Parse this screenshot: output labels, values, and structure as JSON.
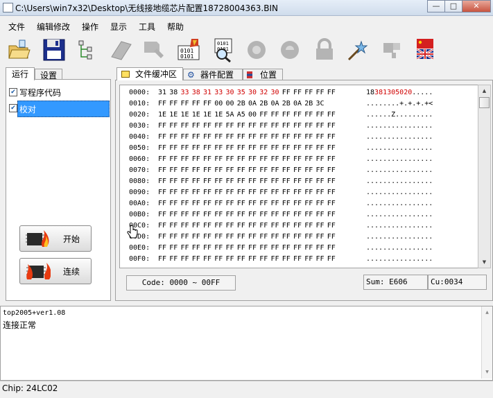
{
  "window": {
    "title": "C:\\Users\\win7x32\\Desktop\\无线接地缆芯片配置18728004363.BIN",
    "minimize": "—",
    "maximize": "□",
    "close": "✕"
  },
  "menu": [
    "文件",
    "编辑修改",
    "操作",
    "显示",
    "工具",
    "帮助"
  ],
  "toolbar": [
    {
      "name": "open-folder-icon"
    },
    {
      "name": "save-disk-icon"
    },
    {
      "name": "tree-icon"
    },
    {
      "name": "erase-icon"
    },
    {
      "name": "blank-check-icon"
    },
    {
      "name": "program-icon"
    },
    {
      "name": "read-icon"
    },
    {
      "name": "verify-icon"
    },
    {
      "name": "encrypt-icon"
    },
    {
      "name": "lock-icon"
    },
    {
      "name": "magic-icon"
    },
    {
      "name": "chip-icon"
    },
    {
      "name": "language-flag-icon"
    }
  ],
  "left_tabs": [
    "运行",
    "设置"
  ],
  "operations": [
    {
      "label": "写程序代码",
      "checked": true,
      "selected": false
    },
    {
      "label": "校对",
      "checked": true,
      "selected": true
    }
  ],
  "buttons": {
    "start": "开始",
    "continuous": "连续"
  },
  "right_tabs": [
    "文件缓冲区",
    "器件配置",
    "位置"
  ],
  "hex_rows": [
    {
      "addr": "0000:",
      "bytes": [
        "31",
        "38",
        "33",
        "38",
        "31",
        "33",
        "30",
        "35",
        "30",
        "32",
        "30",
        "FF",
        "FF",
        "FF",
        "FF",
        "FF"
      ],
      "red_from": 2,
      "red_to": 10,
      "ascii_plain": "18",
      "ascii_red": "381305020",
      "ascii_tail": "....."
    },
    {
      "addr": "0010:",
      "bytes": [
        "FF",
        "FF",
        "FF",
        "FF",
        "FF",
        "00",
        "00",
        "2B",
        "0A",
        "2B",
        "0A",
        "2B",
        "0A",
        "2B",
        "3C"
      ],
      "red_from": -1,
      "red_to": -1,
      "ascii_plain": "........+.+.+.+<",
      "ascii_red": "",
      "ascii_tail": ""
    },
    {
      "addr": "0020:",
      "bytes": [
        "1E",
        "1E",
        "1E",
        "1E",
        "1E",
        "1E",
        "5A",
        "A5",
        "00",
        "FF",
        "FF",
        "FF",
        "FF",
        "FF",
        "FF",
        "FF"
      ],
      "red_from": -1,
      "red_to": -1,
      "ascii_plain": "......Z.........",
      "ascii_red": "",
      "ascii_tail": ""
    },
    {
      "addr": "0030:",
      "bytes": [
        "FF",
        "FF",
        "FF",
        "FF",
        "FF",
        "FF",
        "FF",
        "FF",
        "FF",
        "FF",
        "FF",
        "FF",
        "FF",
        "FF",
        "FF",
        "FF"
      ],
      "red_from": -1,
      "red_to": -1,
      "ascii_plain": "................",
      "ascii_red": "",
      "ascii_tail": ""
    },
    {
      "addr": "0040:",
      "bytes": [
        "FF",
        "FF",
        "FF",
        "FF",
        "FF",
        "FF",
        "FF",
        "FF",
        "FF",
        "FF",
        "FF",
        "FF",
        "FF",
        "FF",
        "FF",
        "FF"
      ],
      "red_from": -1,
      "red_to": -1,
      "ascii_plain": "................",
      "ascii_red": "",
      "ascii_tail": ""
    },
    {
      "addr": "0050:",
      "bytes": [
        "FF",
        "FF",
        "FF",
        "FF",
        "FF",
        "FF",
        "FF",
        "FF",
        "FF",
        "FF",
        "FF",
        "FF",
        "FF",
        "FF",
        "FF",
        "FF"
      ],
      "red_from": -1,
      "red_to": -1,
      "ascii_plain": "................",
      "ascii_red": "",
      "ascii_tail": ""
    },
    {
      "addr": "0060:",
      "bytes": [
        "FF",
        "FF",
        "FF",
        "FF",
        "FF",
        "FF",
        "FF",
        "FF",
        "FF",
        "FF",
        "FF",
        "FF",
        "FF",
        "FF",
        "FF",
        "FF"
      ],
      "red_from": -1,
      "red_to": -1,
      "ascii_plain": "................",
      "ascii_red": "",
      "ascii_tail": ""
    },
    {
      "addr": "0070:",
      "bytes": [
        "FF",
        "FF",
        "FF",
        "FF",
        "FF",
        "FF",
        "FF",
        "FF",
        "FF",
        "FF",
        "FF",
        "FF",
        "FF",
        "FF",
        "FF",
        "FF"
      ],
      "red_from": -1,
      "red_to": -1,
      "ascii_plain": "................",
      "ascii_red": "",
      "ascii_tail": ""
    },
    {
      "addr": "0080:",
      "bytes": [
        "FF",
        "FF",
        "FF",
        "FF",
        "FF",
        "FF",
        "FF",
        "FF",
        "FF",
        "FF",
        "FF",
        "FF",
        "FF",
        "FF",
        "FF",
        "FF"
      ],
      "red_from": -1,
      "red_to": -1,
      "ascii_plain": "................",
      "ascii_red": "",
      "ascii_tail": ""
    },
    {
      "addr": "0090:",
      "bytes": [
        "FF",
        "FF",
        "FF",
        "FF",
        "FF",
        "FF",
        "FF",
        "FF",
        "FF",
        "FF",
        "FF",
        "FF",
        "FF",
        "FF",
        "FF",
        "FF"
      ],
      "red_from": -1,
      "red_to": -1,
      "ascii_plain": "................",
      "ascii_red": "",
      "ascii_tail": ""
    },
    {
      "addr": "00A0:",
      "bytes": [
        "FF",
        "FF",
        "FF",
        "FF",
        "FF",
        "FF",
        "FF",
        "FF",
        "FF",
        "FF",
        "FF",
        "FF",
        "FF",
        "FF",
        "FF",
        "FF"
      ],
      "red_from": -1,
      "red_to": -1,
      "ascii_plain": "................",
      "ascii_red": "",
      "ascii_tail": ""
    },
    {
      "addr": "00B0:",
      "bytes": [
        "FF",
        "FF",
        "FF",
        "FF",
        "FF",
        "FF",
        "FF",
        "FF",
        "FF",
        "FF",
        "FF",
        "FF",
        "FF",
        "FF",
        "FF",
        "FF"
      ],
      "red_from": -1,
      "red_to": -1,
      "ascii_plain": "................",
      "ascii_red": "",
      "ascii_tail": ""
    },
    {
      "addr": "00C0:",
      "bytes": [
        "FF",
        "FF",
        "FF",
        "FF",
        "FF",
        "FF",
        "FF",
        "FF",
        "FF",
        "FF",
        "FF",
        "FF",
        "FF",
        "FF",
        "FF",
        "FF"
      ],
      "red_from": -1,
      "red_to": -1,
      "ascii_plain": "................",
      "ascii_red": "",
      "ascii_tail": ""
    },
    {
      "addr": "00D0:",
      "bytes": [
        "FF",
        "FF",
        "FF",
        "FF",
        "FF",
        "FF",
        "FF",
        "FF",
        "FF",
        "FF",
        "FF",
        "FF",
        "FF",
        "FF",
        "FF",
        "FF"
      ],
      "red_from": -1,
      "red_to": -1,
      "ascii_plain": "................",
      "ascii_red": "",
      "ascii_tail": ""
    },
    {
      "addr": "00E0:",
      "bytes": [
        "FF",
        "FF",
        "FF",
        "FF",
        "FF",
        "FF",
        "FF",
        "FF",
        "FF",
        "FF",
        "FF",
        "FF",
        "FF",
        "FF",
        "FF",
        "FF"
      ],
      "red_from": -1,
      "red_to": -1,
      "ascii_plain": "................",
      "ascii_red": "",
      "ascii_tail": ""
    },
    {
      "addr": "00F0:",
      "bytes": [
        "FF",
        "FF",
        "FF",
        "FF",
        "FF",
        "FF",
        "FF",
        "FF",
        "FF",
        "FF",
        "FF",
        "FF",
        "FF",
        "FF",
        "FF",
        "FF"
      ],
      "red_from": -1,
      "red_to": -1,
      "ascii_plain": "................",
      "ascii_red": "",
      "ascii_tail": ""
    }
  ],
  "code_range": "Code: 0000 ~ 00FF",
  "sum": "Sum:  E606",
  "cu": "Cu:0034",
  "log_lines": [
    "top2005+ver1.08",
    "连接正常"
  ],
  "status": {
    "chip": "Chip:  24LC02"
  },
  "colors": {
    "highlight": "#3399ff",
    "hex_red": "#d00000"
  }
}
